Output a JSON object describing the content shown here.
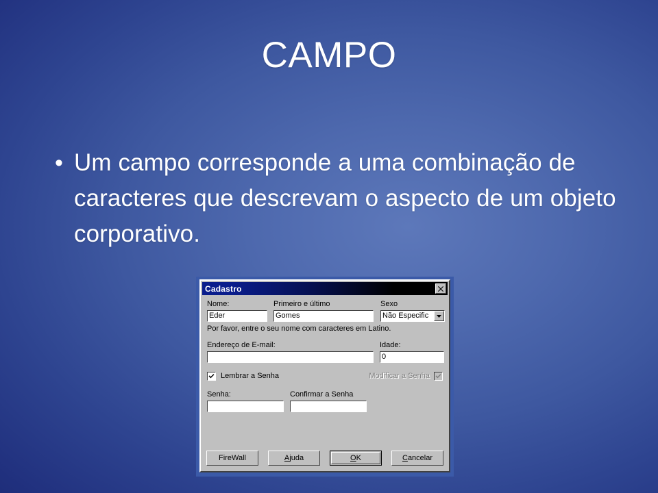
{
  "slide": {
    "title": "CAMPO",
    "bullet_marker": "•",
    "body_text": "Um campo corresponde a uma combinação de caracteres que descrevam o aspecto de um objeto corporativo.",
    "background_center_color": "#5d78ba",
    "background_edge_color": "#142159",
    "text_color": "#ffffff"
  },
  "dialog": {
    "title": "Cadastro",
    "close_icon": "close-icon",
    "frame_color": "#3b5aa8",
    "face_color": "#c0c0c0",
    "titlebar_color": "#0a1d8c",
    "fields": {
      "nome_label": "Nome:",
      "nome_value": "Eder",
      "primeiro_ultimo_label": "Primeiro e último",
      "primeiro_ultimo_value": "Gomes",
      "sexo_label": "Sexo",
      "sexo_value": "Não Especific",
      "sexo_arrow_icon": "chevron-down-icon",
      "helper_text": "Por favor, entre o seu nome com caracteres em Latino.",
      "email_label": "Endereço de E-mail:",
      "email_value": "",
      "idade_label": "Idade:",
      "idade_value": "0",
      "senha_label": "Senha:",
      "senha_value": "",
      "confirmar_senha_label": "Confirmar a Senha",
      "confirmar_senha_value": ""
    },
    "checkboxes": {
      "lembrar_label": "Lembrar a Senha",
      "lembrar_checked": true,
      "modificar_label": "Modificar a Senha",
      "modificar_checked": true,
      "modificar_disabled": true,
      "check_icon": "check-icon"
    },
    "buttons": {
      "firewall": "FireWall",
      "ajuda_prefix": "",
      "ajuda_accel": "A",
      "ajuda_suffix": "juda",
      "ok_accel": "O",
      "ok_suffix": "K",
      "cancelar_accel": "C",
      "cancelar_suffix": "ancelar"
    }
  }
}
